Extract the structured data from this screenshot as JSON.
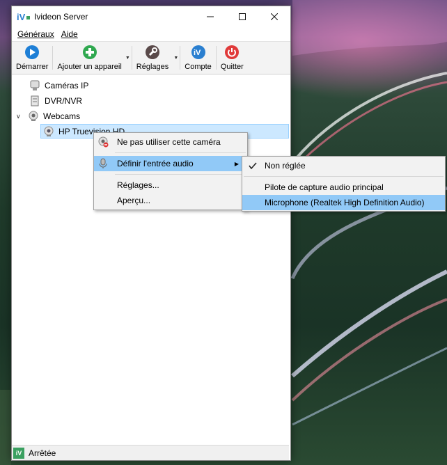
{
  "window": {
    "title": "Ivideon Server",
    "minimize_icon": "minimize-icon",
    "maximize_icon": "maximize-icon",
    "close_icon": "close-icon"
  },
  "menubar": {
    "items": [
      {
        "label": "Généraux"
      },
      {
        "label": "Aide"
      }
    ]
  },
  "toolbar": {
    "start": {
      "label": "Démarrer",
      "icon": "play-icon",
      "color": "#1e7fd6"
    },
    "add_device": {
      "label": "Ajouter un appareil",
      "icon": "plus-icon",
      "color": "#2fa84f"
    },
    "settings": {
      "label": "Réglages",
      "icon": "wrench-icon",
      "color": "#5a4a4a"
    },
    "account": {
      "label": "Compte",
      "icon": "ivideon-icon",
      "color": "#2a7fd0"
    },
    "quit": {
      "label": "Quitter",
      "icon": "power-icon",
      "color": "#e03a3a"
    }
  },
  "tree": {
    "ip_cameras": "Caméras IP",
    "dvr_nvr": "DVR/NVR",
    "webcams": "Webcams",
    "camera": "HP Truevision HD"
  },
  "context_menu": {
    "disable_camera": "Ne pas utiliser cette caméra",
    "set_audio_input": "Définir l'entrée audio",
    "settings": "Réglages...",
    "preview": "Aperçu..."
  },
  "submenu": {
    "not_set": "Non réglée",
    "primary_driver": "Pilote de capture audio principal",
    "microphone": "Microphone (Realtek High Definition Audio)",
    "checked": "Non réglée"
  },
  "status": {
    "text": "Arrêtée",
    "icon": "ivideon-status-icon"
  },
  "colors": {
    "highlight": "#91c9f7",
    "selection": "#cce8ff"
  }
}
